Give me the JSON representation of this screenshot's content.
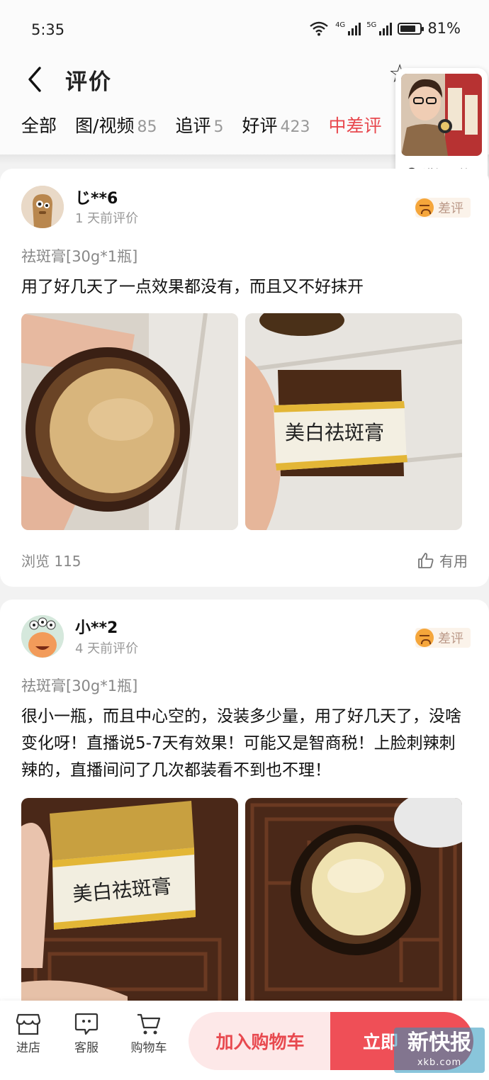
{
  "status_bar": {
    "time": "5:35",
    "wifi_label": "6",
    "net1": "4G",
    "net2": "5G",
    "battery": "81%",
    "battery_level": 0.81
  },
  "header": {
    "title": "评价",
    "tabs": [
      {
        "label": "全部",
        "count": ""
      },
      {
        "label": "图/视频",
        "count": "85"
      },
      {
        "label": "追评",
        "count": "5"
      },
      {
        "label": "好评",
        "count": "423"
      },
      {
        "label": "中差评",
        "count": ""
      }
    ],
    "active_tab": 4
  },
  "live_card": {
    "replay_label": "讲解回放"
  },
  "reviews": [
    {
      "user": "じ**6",
      "time": "1 天前评价",
      "rating": "差评",
      "sku": "祛斑膏[30g*1瓶]",
      "content": "用了好几天了一点效果都没有，而且又不好抹开",
      "views": "浏览 115",
      "useful": "有用",
      "photos": [
        {
          "label": ""
        },
        {
          "label": "美白祛斑膏"
        }
      ]
    },
    {
      "user": "小**2",
      "time": "4 天前评价",
      "rating": "差评",
      "sku": "祛斑膏[30g*1瓶]",
      "content": "很小一瓶，而且中心空的，没装多少量，用了好几天了，没啥变化呀！直播说5-7天有效果！可能又是智商税！上脸刺辣刺辣的，直播间问了几次都装看不到也不理！",
      "photos": [
        {
          "label": "美白祛斑膏"
        },
        {
          "label": ""
        }
      ]
    }
  ],
  "bottom_bar": {
    "store": "进店",
    "service": "客服",
    "cart": "购物车",
    "add_to_cart": "加入购物车",
    "buy_now": "立即"
  },
  "watermark": {
    "text": "新快报",
    "sub": "xkb.com"
  },
  "colors": {
    "accent": "#e8494f",
    "badge_bg": "#fbf3ea",
    "buy_bg": "#ef4f57"
  }
}
